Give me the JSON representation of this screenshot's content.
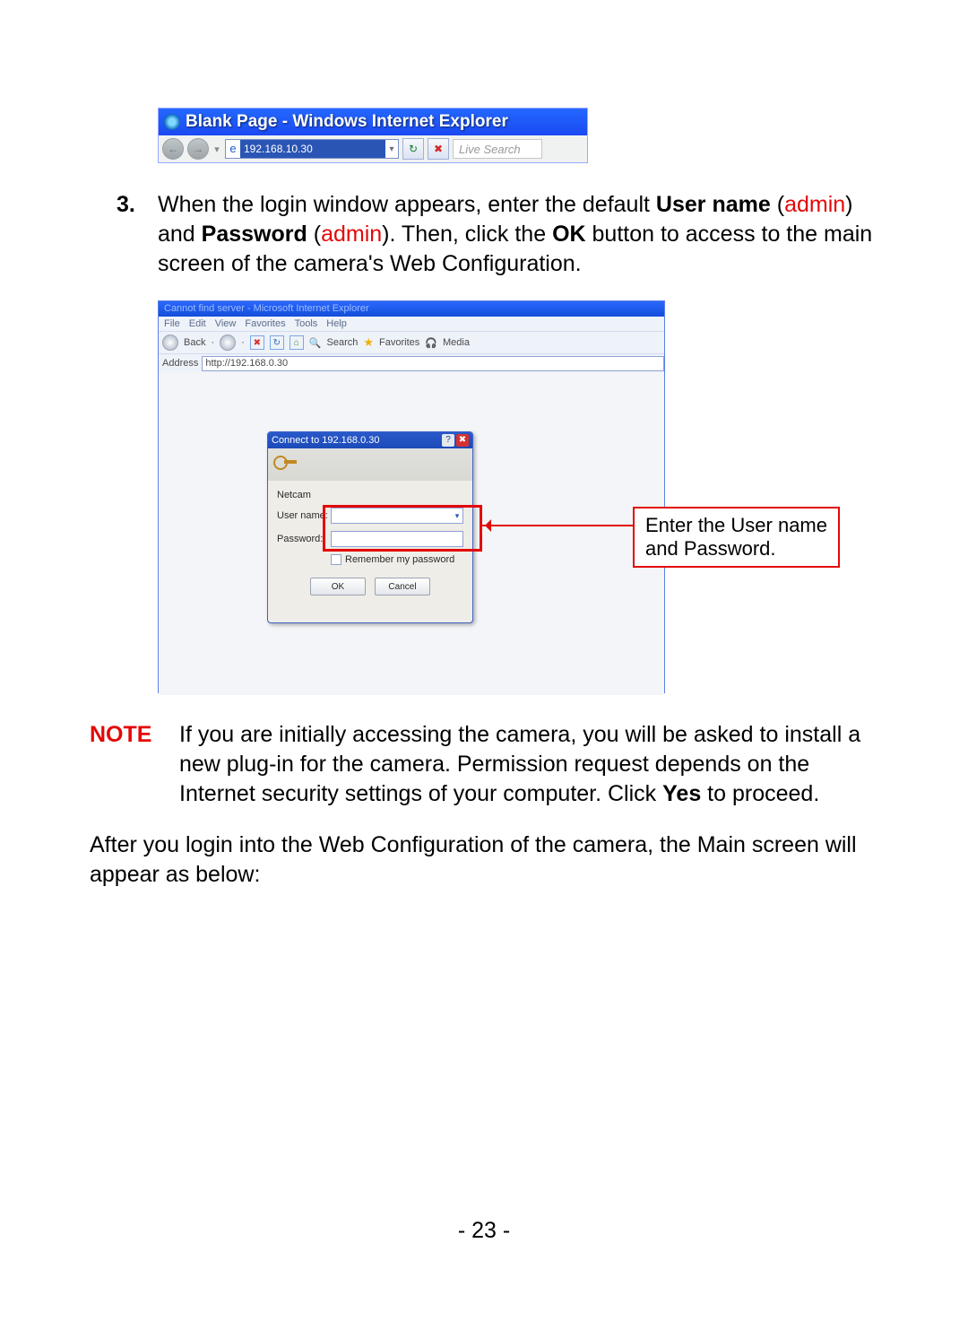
{
  "browserbar": {
    "title": "Blank Page - Windows Internet Explorer",
    "address": "192.168.10.30",
    "search_placeholder": "Live Search"
  },
  "step3": {
    "number": "3.",
    "t1": "When the login window appears, enter the default ",
    "b1": "User name",
    "t2": " (",
    "r1": "admin",
    "t3": ") and ",
    "b2": "Password",
    "t4": " (",
    "r2": "admin",
    "t5": "). Then, click the ",
    "b3": "OK",
    "t6": " button to access to the main screen of the camera's Web Configuration."
  },
  "iewin": {
    "title": "Cannot find server - Microsoft Internet Explorer",
    "menu": [
      "File",
      "Edit",
      "View",
      "Favorites",
      "Tools",
      "Help"
    ],
    "back": "Back",
    "search": "Search",
    "favorites": "Favorites",
    "media": "Media",
    "address_label": "Address",
    "address_url": "http://192.168.0.30"
  },
  "auth": {
    "title": "Connect to 192.168.0.30",
    "realm": "Netcam",
    "user_label": "User name:",
    "pass_label": "Password:",
    "remember": "Remember my password",
    "ok": "OK",
    "cancel": "Cancel"
  },
  "callout": {
    "l1": "Enter the User name",
    "l2": "and Password."
  },
  "note": {
    "label": "NOTE",
    "t1": "If you are initially accessing the camera, you will be asked to install a new plug-in for the camera. Permission request depends on the Internet security settings of your computer. Click ",
    "b1": "Yes",
    "t2": " to proceed."
  },
  "after": "After you login into the Web Configuration of the camera, the Main screen will appear as below:",
  "page_number": "- 23 -"
}
